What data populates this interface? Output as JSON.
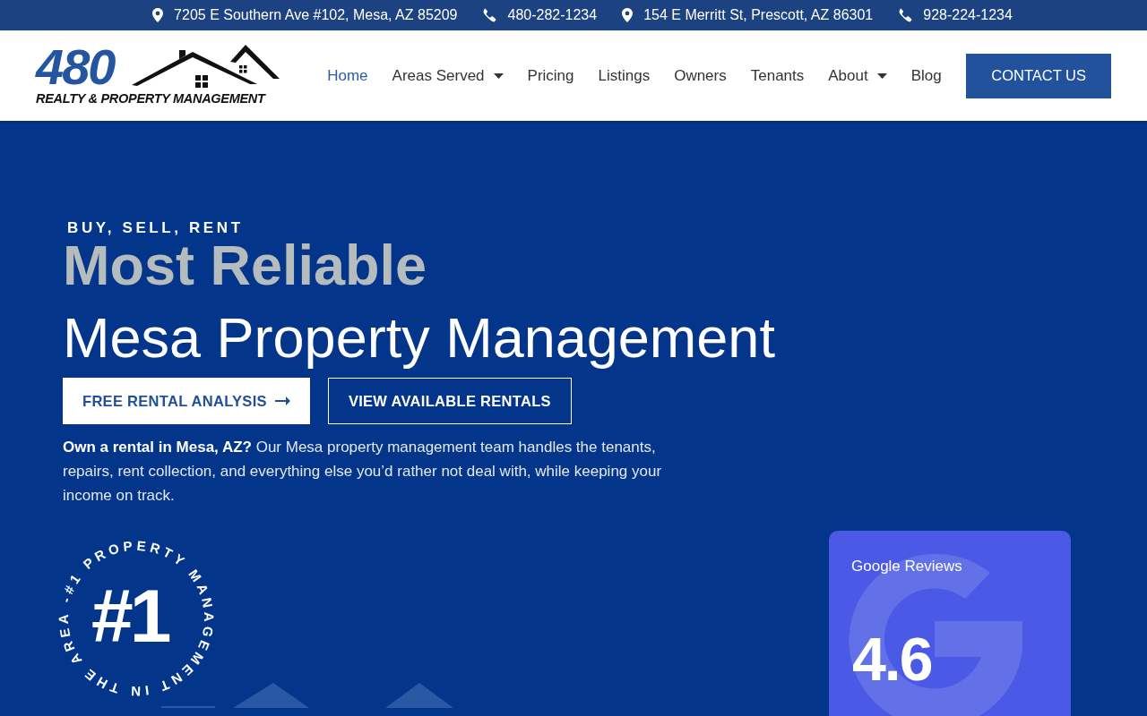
{
  "top_bar": [
    {
      "kind": "address",
      "text": "7205 E Southern Ave #102, Mesa, AZ 85209"
    },
    {
      "kind": "phone",
      "text": "480-282-1234"
    },
    {
      "kind": "address",
      "text": "154 E Merritt St, Prescott, AZ 86301"
    },
    {
      "kind": "phone",
      "text": "928-224-1234"
    }
  ],
  "logo": {
    "number": "480",
    "tagline": "REALTY & PROPERTY MANAGEMENT"
  },
  "nav": [
    {
      "label": "Home",
      "selected": true,
      "dropdown": false
    },
    {
      "label": "Areas Served",
      "selected": false,
      "dropdown": true
    },
    {
      "label": "Pricing",
      "selected": false,
      "dropdown": false
    },
    {
      "label": "Listings",
      "selected": false,
      "dropdown": false
    },
    {
      "label": "Owners",
      "selected": false,
      "dropdown": false
    },
    {
      "label": "Tenants",
      "selected": false,
      "dropdown": false
    },
    {
      "label": "About",
      "selected": false,
      "dropdown": true
    },
    {
      "label": "Blog",
      "selected": false,
      "dropdown": false
    }
  ],
  "contact_button": "CONTACT US",
  "hero": {
    "eyebrow": "BUY, SELL, RENT",
    "headline_1": "Most Reliable",
    "headline_2": "Mesa Property Management",
    "buttons": [
      {
        "label": "FREE RENTAL ANALYSIS",
        "kind": "solid"
      },
      {
        "label": "VIEW AVAILABLE RENTALS",
        "kind": "outline"
      }
    ],
    "intro": "**Own a rental in Mesa, AZ?** Our Mesa property management team handles the tenants, repairs, rent collection, and everything else you’d rather not deal with, while keeping your income on track."
  },
  "badge": {
    "number": "#1",
    "ring_text": "#1 PROPERTY MANAGEMENT IN THE AREA -"
  },
  "reviews_card": {
    "title": "Google Reviews",
    "rating": "4.6"
  }
}
